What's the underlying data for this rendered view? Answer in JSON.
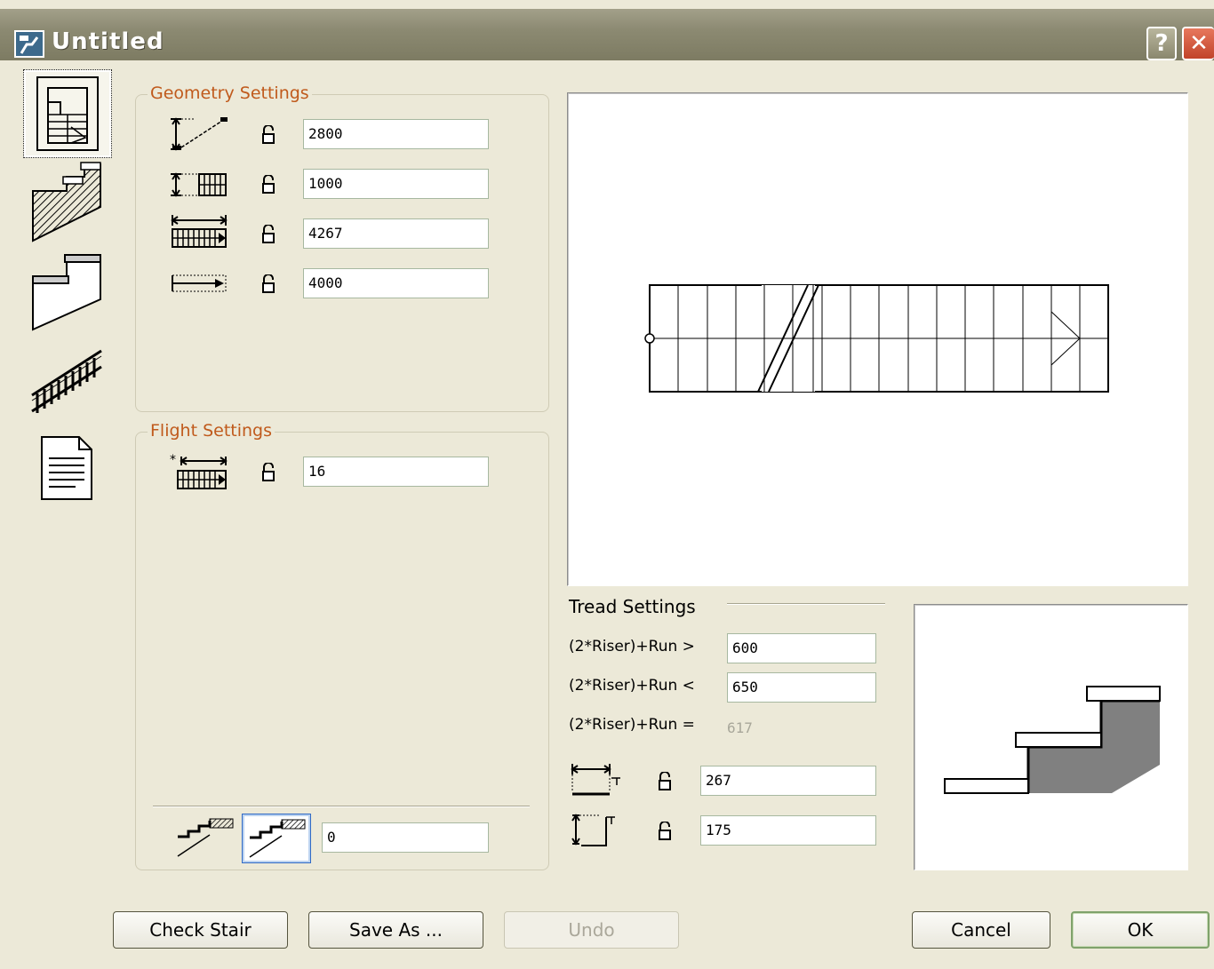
{
  "window": {
    "title": "Untitled"
  },
  "titlebar_buttons": {
    "help": "?",
    "close": "✕"
  },
  "sidebar": {
    "tabs": [
      {
        "name": "plan-tab-icon",
        "selected": true
      },
      {
        "name": "structure-tab-icon",
        "selected": false
      },
      {
        "name": "tread-riser-tab-icon",
        "selected": false
      },
      {
        "name": "railing-tab-icon",
        "selected": false
      },
      {
        "name": "listing-tab-icon",
        "selected": false
      }
    ]
  },
  "geometry": {
    "label": "Geometry Settings",
    "rows": [
      {
        "icon": "stair-height-icon",
        "value": "2800"
      },
      {
        "icon": "stair-width-icon",
        "value": "1000"
      },
      {
        "icon": "stair-length-icon",
        "value": "4267"
      },
      {
        "icon": "walking-line-length-icon",
        "value": "4000"
      }
    ]
  },
  "flight": {
    "label": "Flight Settings",
    "rows": [
      {
        "icon": "number-of-risers-icon",
        "value": "16"
      }
    ],
    "bottom_value": "0"
  },
  "tread": {
    "label": "Tread Settings",
    "min_label": "(2*Riser)+Run >",
    "min_value": "600",
    "max_label": "(2*Riser)+Run <",
    "max_value": "650",
    "eq_label": "(2*Riser)+Run =",
    "eq_value": "617",
    "tread_depth": "267",
    "riser_height": "175"
  },
  "buttons": {
    "check_stair": "Check Stair",
    "save_as": "Save As ...",
    "undo": "Undo",
    "cancel": "Cancel",
    "ok": "OK"
  }
}
